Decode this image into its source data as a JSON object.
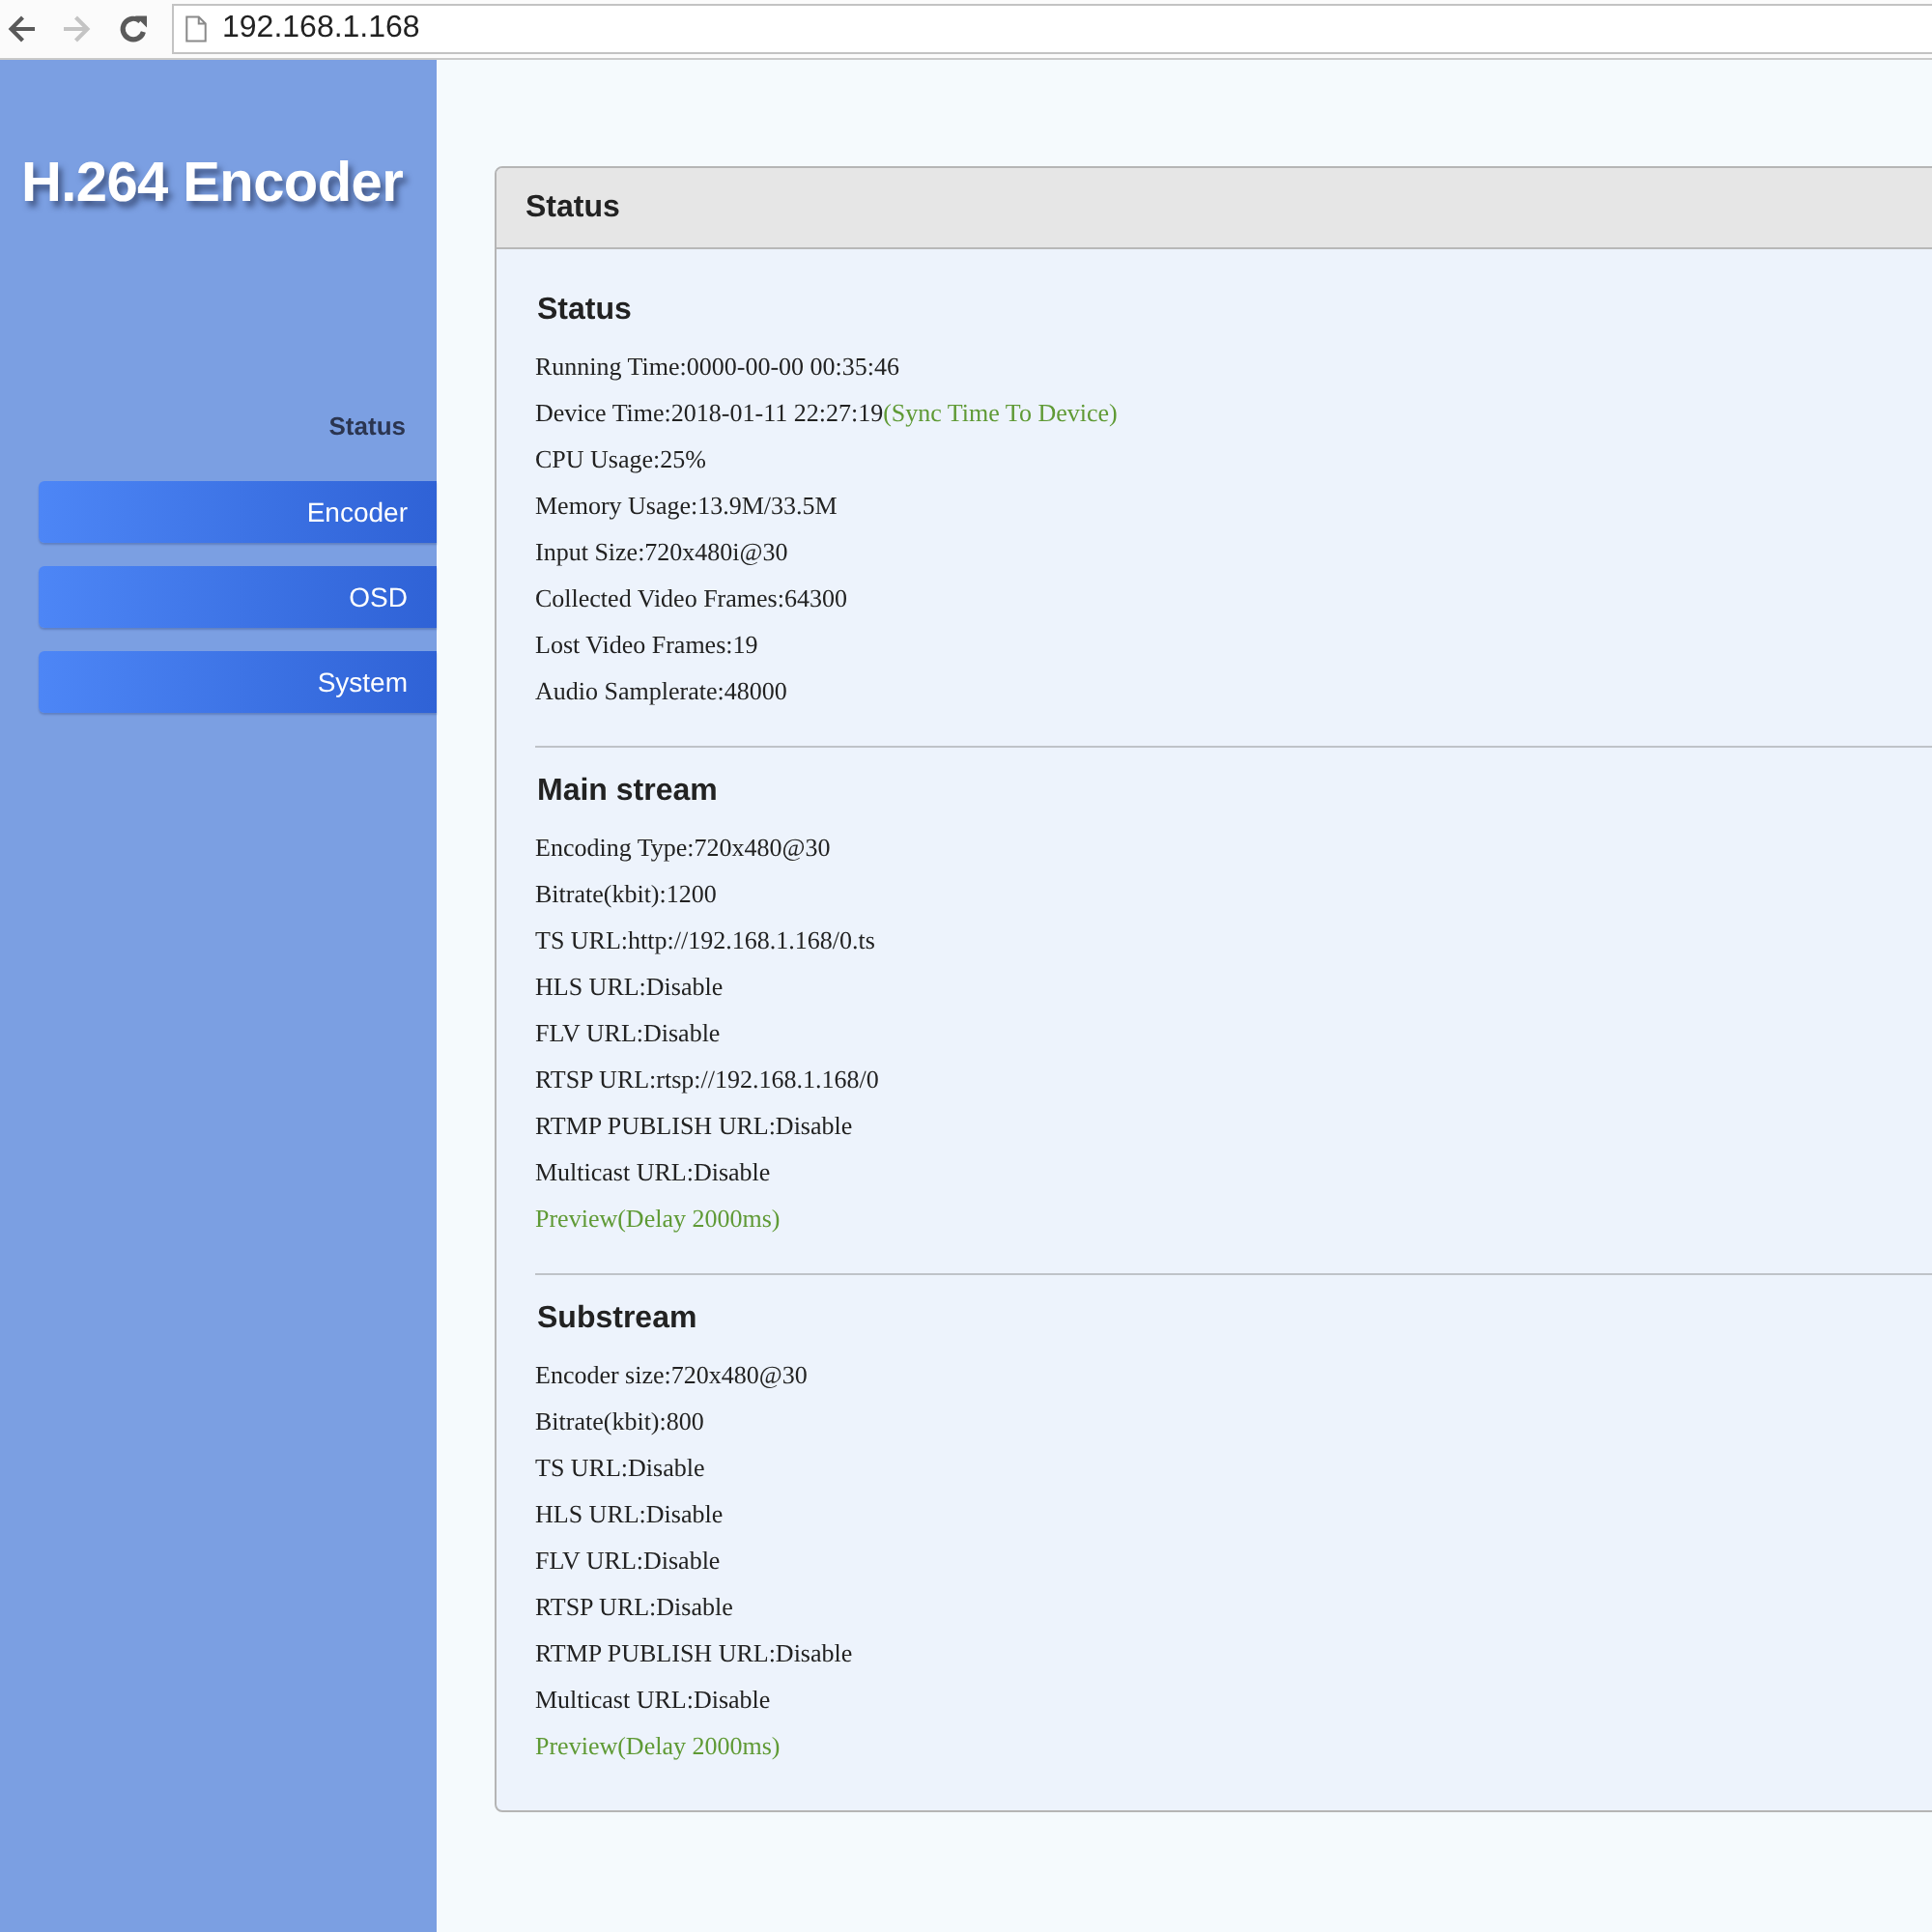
{
  "browser": {
    "nav_buttons": [
      {
        "kind": "back",
        "disabled": false
      },
      {
        "kind": "forward",
        "disabled": true
      },
      {
        "kind": "reload",
        "disabled": false
      }
    ],
    "address": "192.168.1.168"
  },
  "sidebar": {
    "logo": "H.264 Encoder",
    "items": [
      {
        "label": "Status",
        "selected": true
      },
      {
        "label": "Encoder",
        "selected": false
      },
      {
        "label": "OSD",
        "selected": false
      },
      {
        "label": "System",
        "selected": false
      }
    ]
  },
  "panel": {
    "title": "Status",
    "sections": [
      {
        "title": "Status",
        "lines": [
          {
            "kind": "text",
            "text": "Running Time:0000-00-00 00:35:46"
          },
          {
            "kind": "text",
            "text": "Device Time:2018-01-11 22:27:19",
            "link": "(Sync Time To Device)"
          },
          {
            "kind": "text",
            "text": "CPU Usage:25%"
          },
          {
            "kind": "text",
            "text": "Memory Usage:13.9M/33.5M"
          },
          {
            "kind": "text",
            "text": "Input Size:720x480i@30"
          },
          {
            "kind": "text",
            "text": "Collected Video Frames:64300"
          },
          {
            "kind": "text",
            "text": "Lost Video Frames:19"
          },
          {
            "kind": "text",
            "text": "Audio Samplerate:48000"
          }
        ]
      },
      {
        "title": "Main stream",
        "lines": [
          {
            "kind": "text",
            "text": "Encoding Type:720x480@30"
          },
          {
            "kind": "text",
            "text": "Bitrate(kbit):1200"
          },
          {
            "kind": "text",
            "text": "TS URL:http://192.168.1.168/0.ts"
          },
          {
            "kind": "text",
            "text": "HLS URL:Disable"
          },
          {
            "kind": "text",
            "text": "FLV URL:Disable"
          },
          {
            "kind": "text",
            "text": "RTSP URL:rtsp://192.168.1.168/0"
          },
          {
            "kind": "text",
            "text": "RTMP PUBLISH URL:Disable"
          },
          {
            "kind": "text",
            "text": "Multicast URL:Disable"
          },
          {
            "kind": "link",
            "text": "Preview(Delay 2000ms)"
          }
        ]
      },
      {
        "title": "Substream",
        "lines": [
          {
            "kind": "text",
            "text": "Encoder size:720x480@30"
          },
          {
            "kind": "text",
            "text": "Bitrate(kbit):800"
          },
          {
            "kind": "text",
            "text": "TS URL:Disable"
          },
          {
            "kind": "text",
            "text": "HLS URL:Disable"
          },
          {
            "kind": "text",
            "text": "FLV URL:Disable"
          },
          {
            "kind": "text",
            "text": "RTSP URL:Disable"
          },
          {
            "kind": "text",
            "text": "RTMP PUBLISH URL:Disable"
          },
          {
            "kind": "text",
            "text": "Multicast URL:Disable"
          },
          {
            "kind": "link",
            "text": "Preview(Delay 2000ms)"
          }
        ]
      }
    ]
  }
}
